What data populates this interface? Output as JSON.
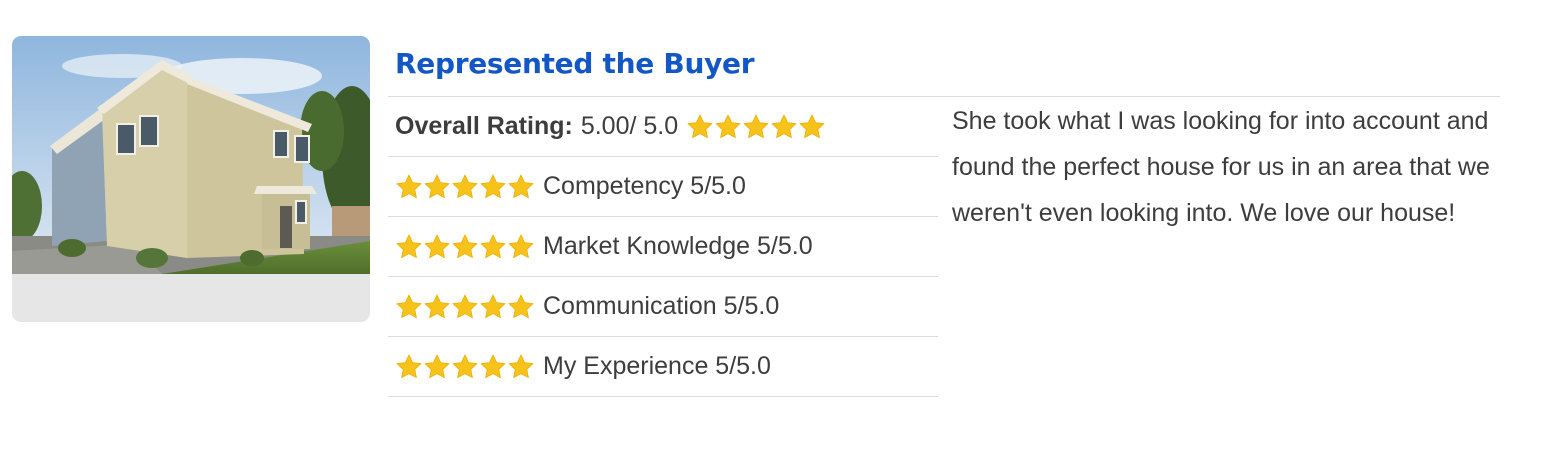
{
  "review_card": {
    "title": "Represented the Buyer",
    "photo_alt": "Two-story beige house with attached garage",
    "overall": {
      "label": "Overall Rating:",
      "value": "5.00/ 5.0",
      "stars": 5
    },
    "categories": [
      {
        "label": "Competency 5/5.0",
        "stars": 5
      },
      {
        "label": "Market Knowledge 5/5.0",
        "stars": 5
      },
      {
        "label": "Communication 5/5.0",
        "stars": 5
      },
      {
        "label": "My Experience 5/5.0",
        "stars": 5
      }
    ],
    "review_text": "She took what I was looking for into account and found the perfect house for us in an area that we weren't even looking into. We love our house!"
  },
  "colors": {
    "title": "#1357c6",
    "star": "#f7c21a",
    "rule": "#dcdcdc",
    "text": "#3d3d3d",
    "card_bg": "#e6e6e6"
  },
  "icons": {
    "star": "star-icon"
  }
}
